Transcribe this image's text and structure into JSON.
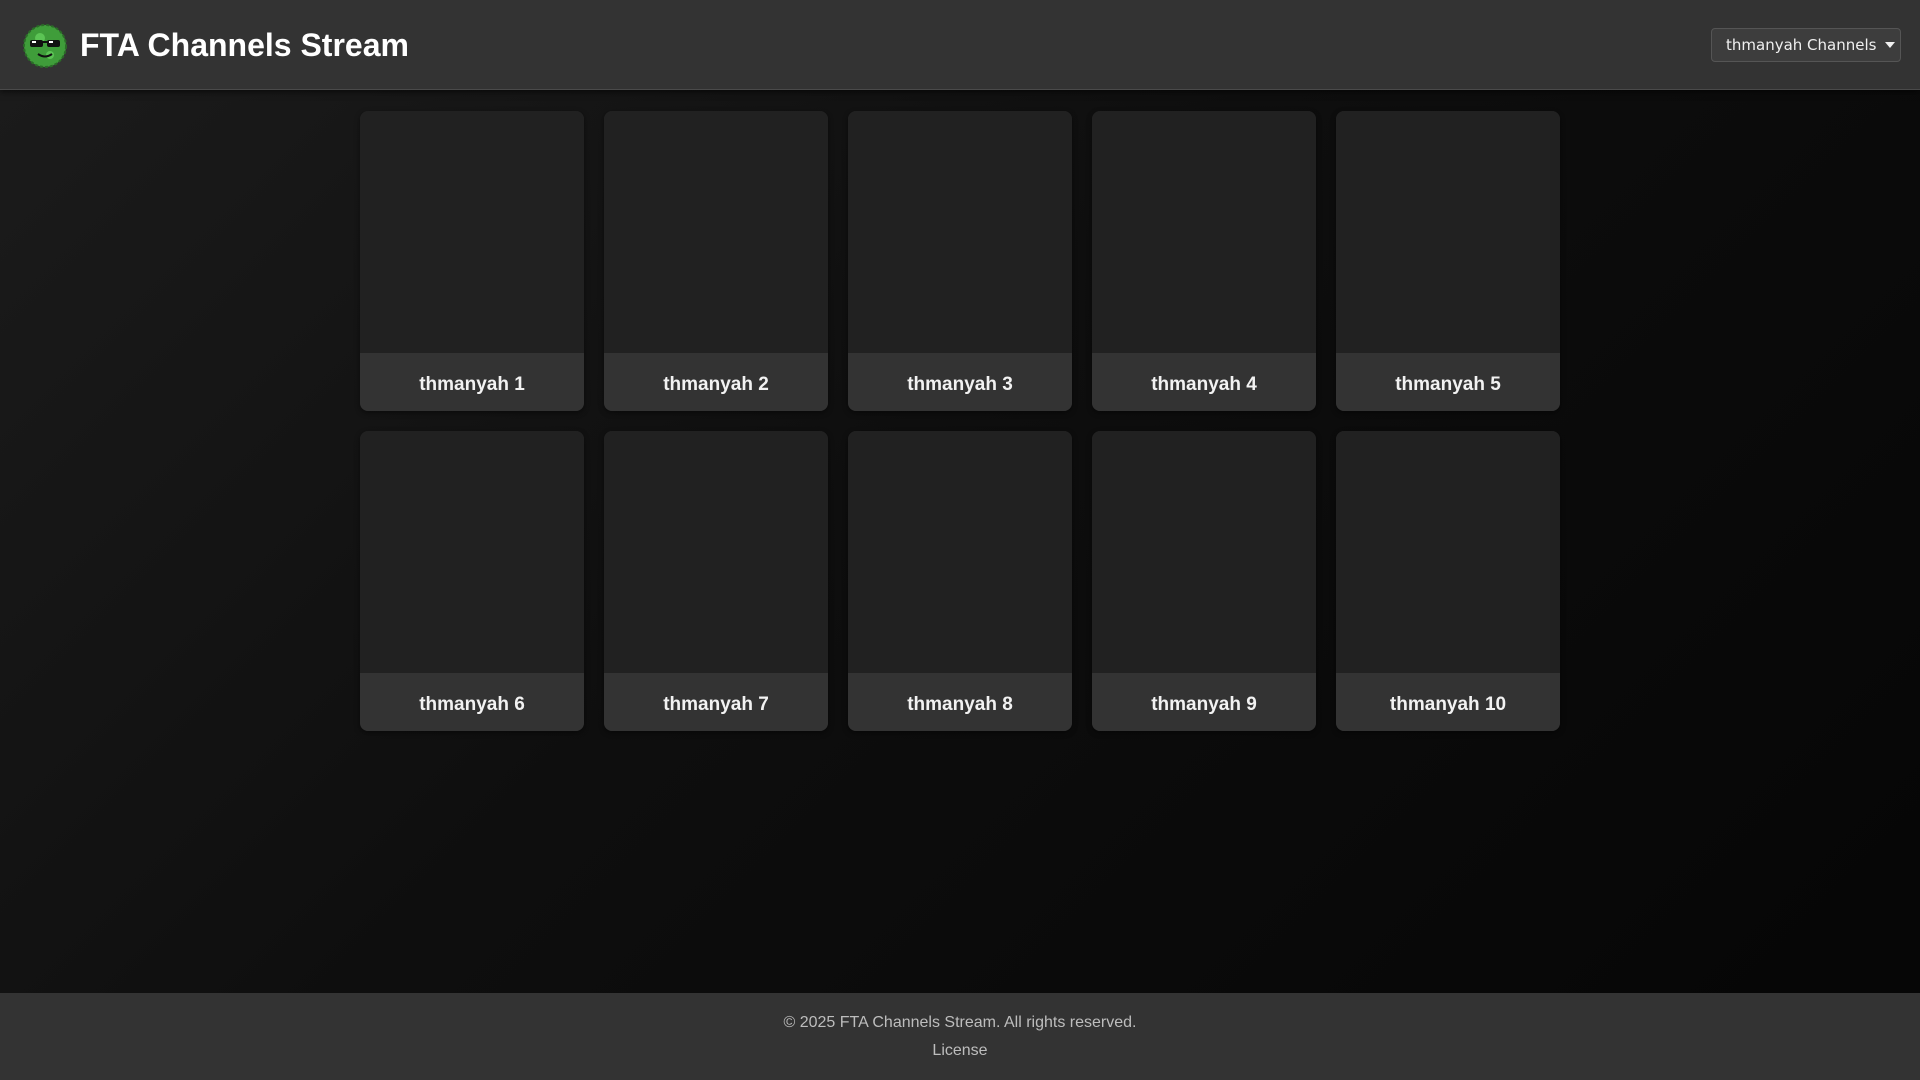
{
  "header": {
    "title": "FTA Channels Stream",
    "logo_icon": "sunglasses-face-logo",
    "channel_select": {
      "selected": "thmanyah Channels"
    }
  },
  "channels": [
    {
      "name": "thmanyah 1"
    },
    {
      "name": "thmanyah 2"
    },
    {
      "name": "thmanyah 3"
    },
    {
      "name": "thmanyah 4"
    },
    {
      "name": "thmanyah 5"
    },
    {
      "name": "thmanyah 6"
    },
    {
      "name": "thmanyah 7"
    },
    {
      "name": "thmanyah 8"
    },
    {
      "name": "thmanyah 9"
    },
    {
      "name": "thmanyah 10"
    }
  ],
  "footer": {
    "copyright": "© 2025 FTA Channels Stream. All rights reserved.",
    "license_link": "License"
  },
  "colors": {
    "header_bg": "#333333",
    "card_bg": "#212121",
    "card_label_bg": "#333333",
    "logo_green": "#4caf50"
  }
}
